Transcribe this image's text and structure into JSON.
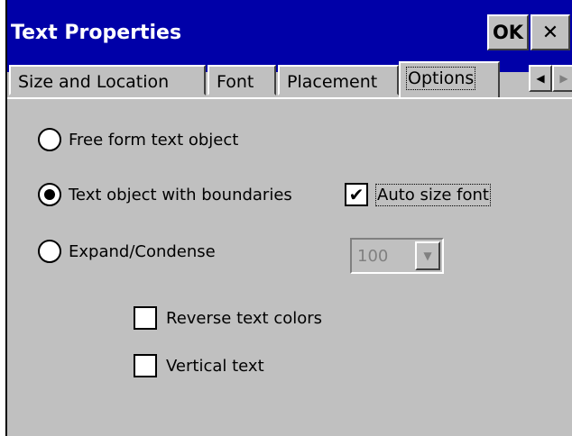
{
  "window": {
    "title": "Text Properties",
    "ok_label": "OK",
    "close_label": "✕"
  },
  "tabs": [
    {
      "label": "Size and Location"
    },
    {
      "label": "Font"
    },
    {
      "label": "Placement"
    },
    {
      "label": "Options",
      "selected": true
    }
  ],
  "tab_scroll": {
    "left": "◀",
    "right": "▶"
  },
  "options": {
    "free_form_label": "Free form text object",
    "boundaries_label": "Text object with boundaries",
    "expand_label": "Expand/Condense",
    "selected_radio": "boundaries",
    "auto_size_label": "Auto size font",
    "auto_size_checked": true,
    "condense_value": "100",
    "reverse_colors_label": "Reverse text colors",
    "reverse_colors_checked": false,
    "vertical_text_label": "Vertical text",
    "vertical_text_checked": false
  },
  "colors": {
    "titlebar": "#0000a8",
    "face": "#c0c0c0"
  }
}
